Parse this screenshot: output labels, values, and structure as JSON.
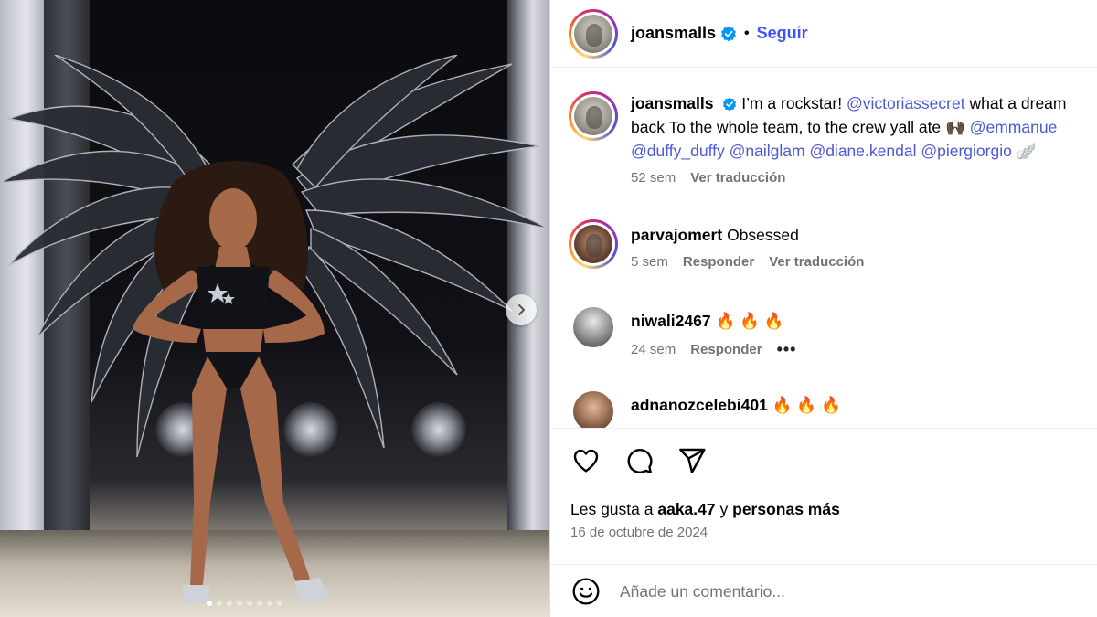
{
  "header": {
    "username": "joansmalls",
    "separator": "•",
    "follow_label": "Seguir"
  },
  "caption": {
    "username": "joansmalls",
    "text_1": "I’m a rockstar!",
    "mention_1": "@victoriassecret",
    "text_2": "what a dream",
    "line2_text": "back To the whole team, to the crew yall ate",
    "line2_emoji": "🙌🏿",
    "mention_2": "@emmanue",
    "mentions_line3": [
      "@duffy_duffy",
      "@nailglam",
      "@diane.kendal",
      "@piergiorgio"
    ],
    "line3_emoji": "🪽",
    "time": "52 sem",
    "translate_label": "Ver traducción"
  },
  "comments": [
    {
      "username": "parvajomert",
      "text": "Obsessed",
      "time": "5 sem",
      "reply_label": "Responder",
      "translate_label": "Ver traducción"
    },
    {
      "username": "niwali2467",
      "text": "🔥 🔥 🔥",
      "time": "24 sem",
      "reply_label": "Responder",
      "more_label": "•••"
    },
    {
      "username": "adnanozcelebi401",
      "text": "🔥 🔥 🔥"
    }
  ],
  "likes": {
    "prefix": "Les gusta a",
    "user": "aaka.47",
    "middle": "y",
    "suffix": "personas más"
  },
  "date": "16 de octubre de 2024",
  "add_comment": {
    "placeholder": "Añade un comentario..."
  },
  "carousel": {
    "total": 8,
    "active_index": 0
  },
  "colors": {
    "link": "#4150f7",
    "mention": "#4b58d8",
    "verified": "#0095f6",
    "secondary_text": "#737373"
  },
  "icons": [
    "verified-badge-icon",
    "heart-icon",
    "comment-icon",
    "share-icon",
    "emoji-icon",
    "chevron-right-icon",
    "more-icon"
  ]
}
